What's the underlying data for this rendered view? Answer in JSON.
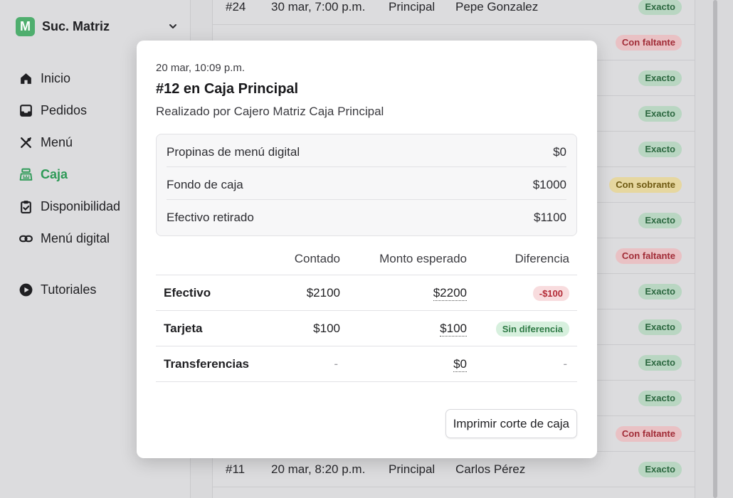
{
  "sidebar": {
    "brand_letter": "M",
    "brand_name": "Suc. Matriz",
    "accent": "#2e9a57",
    "items": [
      {
        "label": "Inicio",
        "icon": "home-icon"
      },
      {
        "label": "Pedidos",
        "icon": "inbox-icon"
      },
      {
        "label": "Menú",
        "icon": "utensils-icon"
      },
      {
        "label": "Caja",
        "icon": "cash-register-icon",
        "active": true
      },
      {
        "label": "Disponibilidad",
        "icon": "clipboard-check-icon"
      },
      {
        "label": "Menú digital",
        "icon": "link-icon"
      },
      {
        "label": "Tutoriales",
        "icon": "play-circle-icon"
      }
    ]
  },
  "background_rows": [
    {
      "id": "#24",
      "date": "30 mar, 7:00 p.m.",
      "caja": "Principal",
      "name": "Pepe Gonzalez",
      "badge": "Exacto",
      "status": "green"
    },
    {
      "id": "",
      "date": "",
      "caja": "",
      "name": "",
      "badge": "Con faltante",
      "status": "red"
    },
    {
      "id": "",
      "date": "",
      "caja": "",
      "name": "",
      "badge": "Exacto",
      "status": "green"
    },
    {
      "id": "",
      "date": "",
      "caja": "",
      "name": "",
      "badge": "Exacto",
      "status": "green"
    },
    {
      "id": "",
      "date": "",
      "caja": "",
      "name": "",
      "badge": "Exacto",
      "status": "green"
    },
    {
      "id": "",
      "date": "",
      "caja": "",
      "name": "",
      "badge": "Con sobrante",
      "status": "yellow"
    },
    {
      "id": "",
      "date": "",
      "caja": "",
      "name": "",
      "badge": "Exacto",
      "status": "green"
    },
    {
      "id": "",
      "date": "",
      "caja": "",
      "name": "",
      "badge": "Con faltante",
      "status": "red"
    },
    {
      "id": "",
      "date": "",
      "caja": "",
      "name": "",
      "badge": "Exacto",
      "status": "green"
    },
    {
      "id": "",
      "date": "",
      "caja": "",
      "name": "",
      "badge": "Exacto",
      "status": "green"
    },
    {
      "id": "",
      "date": "",
      "caja": "",
      "name": "",
      "badge": "Exacto",
      "status": "green"
    },
    {
      "id": "",
      "date": "",
      "caja": "",
      "name": "",
      "badge": "Exacto",
      "status": "green"
    },
    {
      "id": "",
      "date": "",
      "caja": "",
      "name": "",
      "badge": "Con faltante",
      "status": "red"
    },
    {
      "id": "#11",
      "date": "20 mar, 8:20 p.m.",
      "caja": "Principal",
      "name": "Carlos Pérez",
      "badge": "Exacto",
      "status": "green"
    }
  ],
  "modal": {
    "date": "20 mar, 10:09 p.m.",
    "title": "#12 en Caja Principal",
    "subtitle": "Realizado por Cajero Matriz Caja Principal",
    "summary": [
      {
        "label": "Propinas de menú digital",
        "value": "$0"
      },
      {
        "label": "Fondo de caja",
        "value": "$1000"
      },
      {
        "label": "Efectivo retirado",
        "value": "$1100"
      }
    ],
    "table_headers": {
      "counted": "Contado",
      "expected": "Monto esperado",
      "difference": "Diferencia"
    },
    "rows": [
      {
        "name": "Efectivo",
        "counted": "$2100",
        "expected": "$2200",
        "difference": "-$100",
        "diff_type": "red"
      },
      {
        "name": "Tarjeta",
        "counted": "$100",
        "expected": "$100",
        "difference": "Sin diferencia",
        "diff_type": "green"
      },
      {
        "name": "Transferencias",
        "counted": "-",
        "expected": "$0",
        "difference": "-",
        "diff_type": "none"
      }
    ],
    "print_label": "Imprimir corte de caja"
  }
}
